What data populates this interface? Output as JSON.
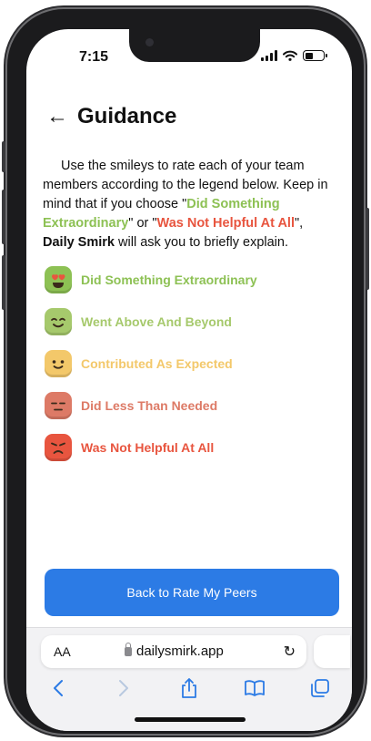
{
  "status_bar": {
    "time": "7:15"
  },
  "page": {
    "title": "Guidance",
    "intro": {
      "p1": "Use the smileys to rate each of your team members according to the legend below. Keep in mind that if you choose \"",
      "opt1": "Did Something Extraordinary",
      "p2": "\" or \"",
      "opt2": "Was Not Helpful At All",
      "p3": "\", ",
      "brand": "Daily Smirk",
      "p4": " will ask you to briefly explain."
    },
    "legend": [
      {
        "label": "Did Something Extraordinary",
        "color": "#8dc154",
        "face": "heart-eyes"
      },
      {
        "label": "Went Above And Beyond",
        "color": "#a6c96c",
        "face": "content"
      },
      {
        "label": "Contributed As Expected",
        "color": "#f3c86a",
        "face": "smile"
      },
      {
        "label": "Did Less Than Needed",
        "color": "#dd7a66",
        "face": "unamused"
      },
      {
        "label": "Was Not Helpful At All",
        "color": "#e8553f",
        "face": "angry"
      }
    ],
    "primary_button": "Back to Rate My Peers"
  },
  "browser": {
    "text_size_label": "AA",
    "url": "dailysmirk.app"
  },
  "colors": {
    "accent": "#2c7be5"
  }
}
